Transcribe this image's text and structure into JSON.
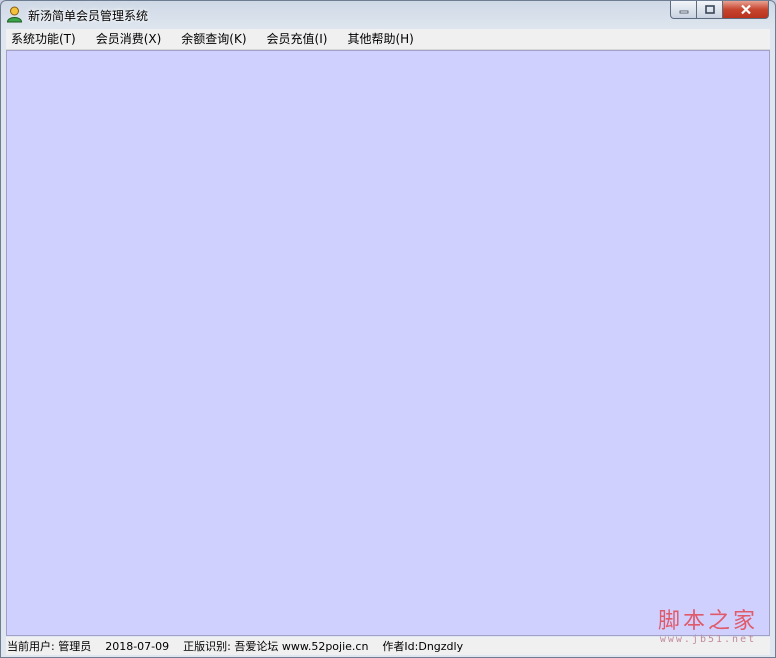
{
  "window": {
    "title": "新汤简单会员管理系统"
  },
  "menu": [
    {
      "label": "系统功能(T)"
    },
    {
      "label": "会员消费(X)"
    },
    {
      "label": "余额查询(K)"
    },
    {
      "label": "会员充值(I)"
    },
    {
      "label": "其他帮助(H)"
    }
  ],
  "status": {
    "user": "当前用户: 管理员",
    "date": "2018-07-09",
    "license": "正版识别: 吾爱论坛 www.52pojie.cn",
    "author": "作者Id:Dngzdly"
  },
  "watermark": {
    "main": "脚本之家",
    "sub": "www.jb51.net"
  },
  "colors": {
    "client_background": "#d0d0ff",
    "close_button": "#c7452f"
  },
  "icons": [
    "app-user-icon",
    "minimize-icon",
    "maximize-icon",
    "close-icon"
  ]
}
